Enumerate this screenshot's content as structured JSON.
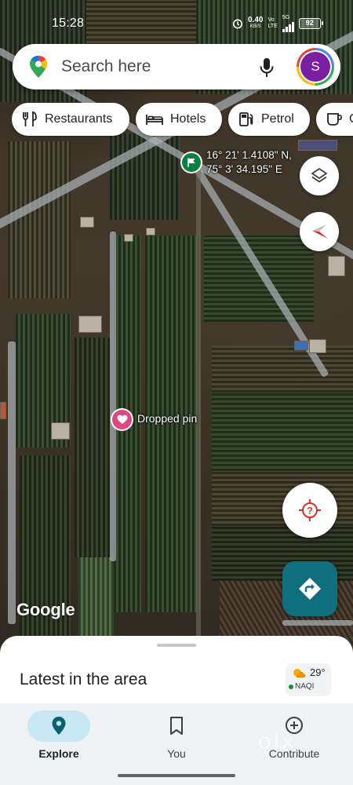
{
  "status_bar": {
    "time": "15:28",
    "net_speed": "0.40",
    "net_speed_unit": "KB/S",
    "volte": "Vo",
    "volte_sub": "LTE",
    "network": "5G",
    "battery": "92"
  },
  "search": {
    "placeholder": "Search here",
    "avatar_letter": "S"
  },
  "chips": [
    {
      "label": "Restaurants",
      "icon": "fork-knife-icon"
    },
    {
      "label": "Hotels",
      "icon": "bed-icon"
    },
    {
      "label": "Petrol",
      "icon": "fuel-pump-icon"
    },
    {
      "label": "C",
      "icon": "coffee-icon"
    }
  ],
  "map": {
    "coordinates_line1": "16° 21' 1.4108\" N,",
    "coordinates_line2": "75° 3' 34.195\" E",
    "dropped_pin_label": "Dropped pin",
    "attribution": "Google",
    "locate_mark": "?"
  },
  "sheet": {
    "title": "Latest in the area",
    "weather_temp": "29°",
    "weather_aqi": "NAQI"
  },
  "nav": {
    "items": [
      {
        "label": "Explore",
        "active": true
      },
      {
        "label": "You",
        "active": false
      },
      {
        "label": "Contribute",
        "active": false
      }
    ]
  },
  "watermark": "olx",
  "colors": {
    "accent_teal": "#0f6f7c",
    "pin_green": "#0b8043",
    "dropped_pin": "#e0467f",
    "avatar": "#7b1fa2",
    "locate_red": "#d93025"
  }
}
